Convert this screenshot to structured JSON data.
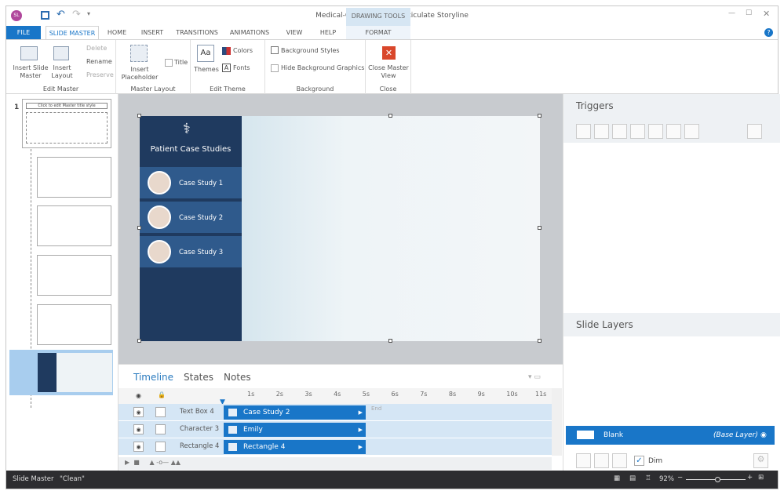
{
  "app": {
    "title": "Medical-Course.story* - Articulate Storyline",
    "logo": "SL"
  },
  "quick_access": [
    "save-icon",
    "undo-icon",
    "redo-icon",
    "customize-icon"
  ],
  "context_tab": {
    "group": "DRAWING TOOLS",
    "tab": "FORMAT"
  },
  "tabs": [
    "FILE",
    "SLIDE MASTER",
    "HOME",
    "INSERT",
    "TRANSITIONS",
    "ANIMATIONS",
    "VIEW",
    "HELP"
  ],
  "active_tab": "SLIDE MASTER",
  "ribbon": {
    "edit_master": {
      "label": "Edit Master",
      "insert_slide_master": "Insert Slide Master",
      "insert_layout": "Insert Layout",
      "delete": "Delete",
      "rename": "Rename",
      "preserve": "Preserve"
    },
    "master_layout": {
      "label": "Master Layout",
      "insert_placeholder": "Insert Placeholder",
      "title": "Title"
    },
    "edit_theme": {
      "label": "Edit Theme",
      "themes": "Themes",
      "colors": "Colors",
      "fonts": "Fonts"
    },
    "background": {
      "label": "Background",
      "background_styles": "Background Styles",
      "hide_background_graphics": "Hide Background Graphics"
    },
    "close": {
      "label": "Close",
      "close_master_view": "Close Master View"
    }
  },
  "thumbnails": {
    "number": "1",
    "master_title": "Click to edit Master title style"
  },
  "slide": {
    "heading": "Patient Case Studies",
    "items": [
      "Case Study 1",
      "Case Study 2",
      "Case Study 3"
    ]
  },
  "timeline": {
    "tabs": [
      "Timeline",
      "States",
      "Notes"
    ],
    "ticks": [
      "1s",
      "2s",
      "3s",
      "4s",
      "5s",
      "6s",
      "7s",
      "8s",
      "9s",
      "10s",
      "11s"
    ],
    "end_label": "End",
    "rows": [
      {
        "name": "Text Box 4",
        "bar": "Case Study 2"
      },
      {
        "name": "Character 3",
        "bar": "Emily"
      },
      {
        "name": "Rectangle 4",
        "bar": "Rectangle 4"
      }
    ]
  },
  "triggers": {
    "title": "Triggers"
  },
  "layers": {
    "title": "Slide Layers",
    "base": {
      "name": "Blank",
      "tag": "(Base Layer)"
    },
    "dim_label": "Dim",
    "dim_checked": true
  },
  "status": {
    "left": "Slide Master",
    "theme": "\"Clean\"",
    "zoom": "92%",
    "zoom_level_percent": 92
  },
  "colors": {
    "accent": "#1976c8",
    "file_tab": "#1976c8",
    "slide_side": "#1f3a5f",
    "status_bar": "#2d2d30"
  }
}
